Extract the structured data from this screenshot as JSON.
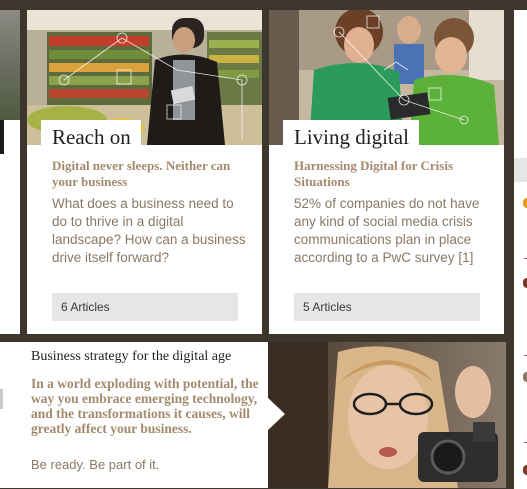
{
  "cards": [
    {
      "title": "Reach on",
      "subtitle": "Digital never sleeps. Neither can your business",
      "description": "What does a business need to do to thrive in a digital landscape? How can a business drive itself forward?",
      "articles": "6 Articles",
      "image": "man-with-tablet-in-supermarket"
    },
    {
      "title": "Living digital",
      "subtitle": "Harnessing Digital for Crisis Situations",
      "description": "52% of companies do not have any kind of social media crisis communications plan in place according to a PwC survey [1]",
      "articles": "5 Articles",
      "image": "teacher-and-boy-with-tablet-in-classroom"
    }
  ],
  "feature": {
    "heading": "Business strategy for the digital age",
    "body": "In a world exploding with potential, the way you embrace emerging technology, and the transformations it causes, will greatly affect your business.",
    "cta": "Be ready. Be part of it.",
    "image": "woman-with-glasses-holding-camera"
  },
  "colors": {
    "background": "#3e352c",
    "subtitle": "#a38a6c",
    "body_text": "#8a7866",
    "articles_bar": "#e6e6e6"
  }
}
